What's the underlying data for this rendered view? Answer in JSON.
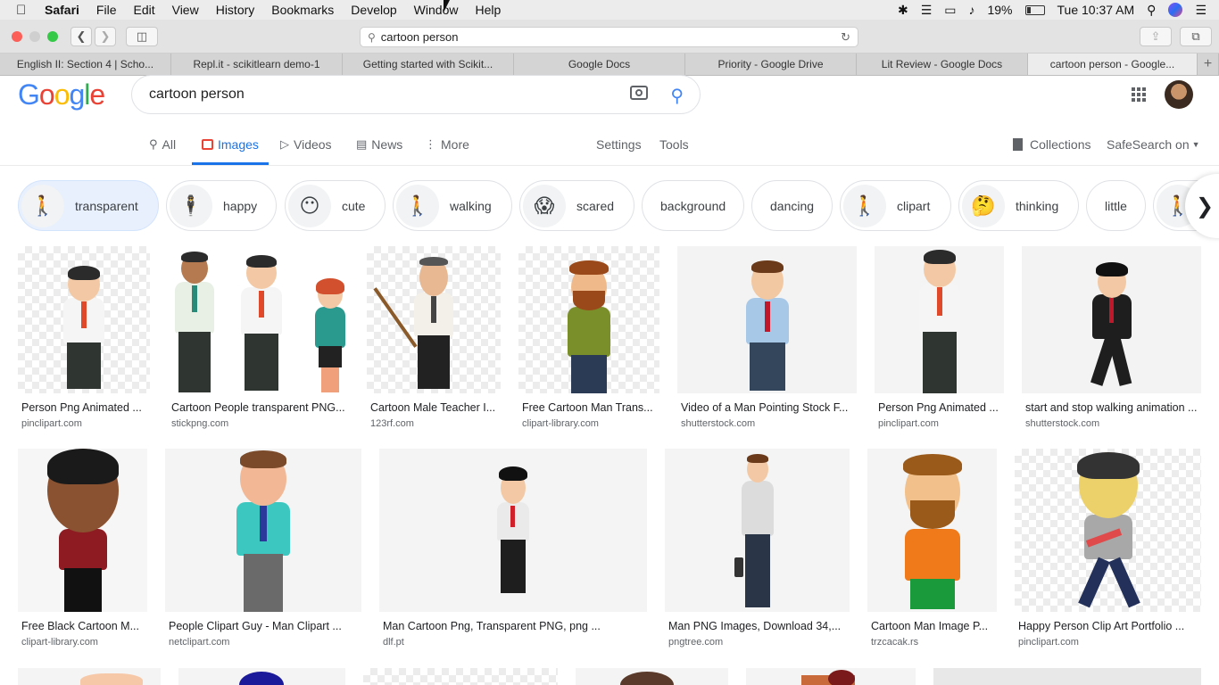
{
  "menubar": {
    "app": "Safari",
    "items": [
      "File",
      "Edit",
      "View",
      "History",
      "Bookmarks",
      "Develop",
      "Window",
      "Help"
    ],
    "battery": "19%",
    "clock": "Tue 10:37 AM"
  },
  "browser": {
    "address": "cartoon person",
    "tabs": [
      "English II: Section 4 | Scho...",
      "Repl.it - scikitlearn demo-1",
      "Getting started with Scikit...",
      "Google Docs",
      "Priority - Google Drive",
      "Lit Review - Google Docs",
      "cartoon person - Google..."
    ],
    "new_tab_label": "+"
  },
  "google": {
    "logo": "Google",
    "query": "cartoon person",
    "nav": {
      "all": "All",
      "images": "Images",
      "videos": "Videos",
      "news": "News",
      "more": "More",
      "settings": "Settings",
      "tools": "Tools",
      "collections": "Collections",
      "safesearch": "SafeSearch on"
    },
    "chips": [
      "transparent",
      "happy",
      "cute",
      "walking",
      "scared",
      "background",
      "dancing",
      "clipart",
      "thinking",
      "little"
    ],
    "results_row1": [
      {
        "caption": "Person Png Animated ...",
        "source": "pinclipart.com"
      },
      {
        "caption": "Cartoon People transparent PNG...",
        "source": "stickpng.com"
      },
      {
        "caption": "Cartoon Male Teacher I...",
        "source": "123rf.com"
      },
      {
        "caption": "Free Cartoon Man Trans...",
        "source": "clipart-library.com"
      },
      {
        "caption": "Video of a Man Pointing Stock F...",
        "source": "shutterstock.com"
      },
      {
        "caption": "Person Png Animated ...",
        "source": "pinclipart.com"
      },
      {
        "caption": "start and stop walking animation ...",
        "source": "shutterstock.com"
      }
    ],
    "results_row2": [
      {
        "caption": "Free Black Cartoon M...",
        "source": "clipart-library.com"
      },
      {
        "caption": "People Clipart Guy - Man Clipart ...",
        "source": "netclipart.com"
      },
      {
        "caption": "Man Cartoon Png, Transparent PNG, png ...",
        "source": "dlf.pt"
      },
      {
        "caption": "Man PNG Images, Download 34,...",
        "source": "pngtree.com"
      },
      {
        "caption": "Cartoon Man Image P...",
        "source": "trzcacak.rs"
      },
      {
        "caption": "Happy Person Clip Art Portfolio ...",
        "source": "pinclipart.com"
      }
    ]
  },
  "colors": {
    "accent": "#1a73e8",
    "chip_selected": "#e8f0fe"
  }
}
